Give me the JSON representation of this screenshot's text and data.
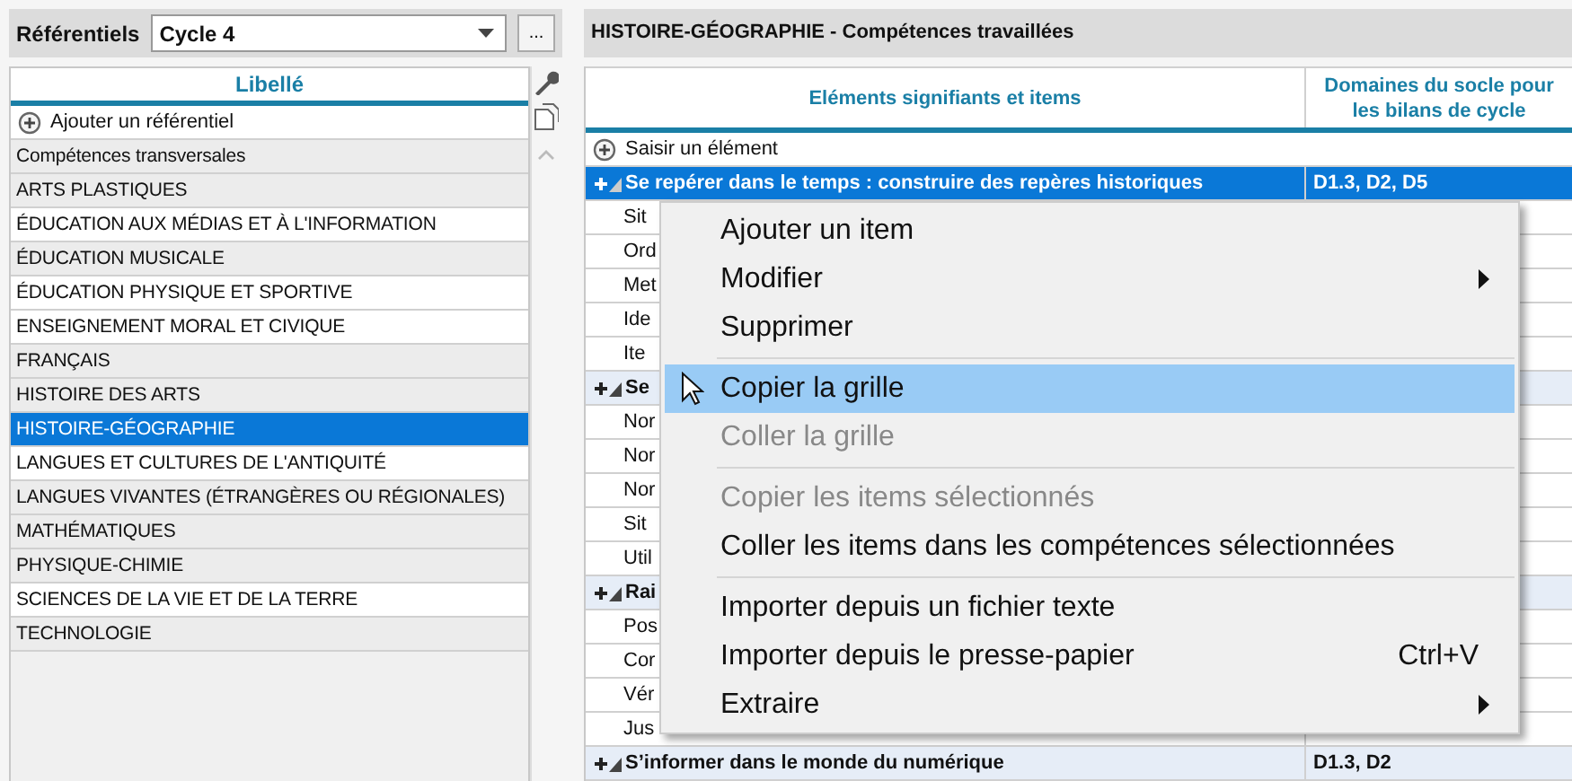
{
  "left_panel": {
    "label": "Référentiels",
    "select": {
      "value": "Cycle 4"
    },
    "more_button": "...",
    "list": {
      "column": "Libellé",
      "add_label": "Ajouter un référentiel",
      "items": [
        {
          "label": "Compétences transversales",
          "shaded": true,
          "selected": false
        },
        {
          "label": "ARTS PLASTIQUES",
          "shaded": true,
          "selected": false
        },
        {
          "label": "ÉDUCATION AUX MÉDIAS ET À L'INFORMATION",
          "shaded": false,
          "selected": false
        },
        {
          "label": "ÉDUCATION MUSICALE",
          "shaded": true,
          "selected": false
        },
        {
          "label": "ÉDUCATION PHYSIQUE ET SPORTIVE",
          "shaded": false,
          "selected": false
        },
        {
          "label": "ENSEIGNEMENT MORAL ET CIVIQUE",
          "shaded": false,
          "selected": false
        },
        {
          "label": "FRANÇAIS",
          "shaded": true,
          "selected": false
        },
        {
          "label": "HISTOIRE DES ARTS",
          "shaded": true,
          "selected": false
        },
        {
          "label": "HISTOIRE-GÉOGRAPHIE",
          "shaded": false,
          "selected": true
        },
        {
          "label": "LANGUES ET CULTURES DE L'ANTIQUITÉ",
          "shaded": false,
          "selected": false
        },
        {
          "label": "LANGUES VIVANTES (ÉTRANGÈRES OU RÉGIONALES)",
          "shaded": true,
          "selected": false
        },
        {
          "label": "MATHÉMATIQUES",
          "shaded": true,
          "selected": false
        },
        {
          "label": "PHYSIQUE-CHIMIE",
          "shaded": true,
          "selected": false
        },
        {
          "label": "SCIENCES DE LA VIE ET DE LA TERRE",
          "shaded": false,
          "selected": false
        },
        {
          "label": "TECHNOLOGIE",
          "shaded": true,
          "selected": false
        }
      ]
    }
  },
  "right_panel": {
    "title": "HISTOIRE-GÉOGRAPHIE - Compétences travaillées",
    "table": {
      "columns": [
        "Eléments signifiants et items",
        "Domaines du socle pour les bilans de cycle"
      ],
      "add_label": "Saisir un élément",
      "rows": [
        {
          "kind": "group",
          "text": "Se repérer dans le temps : construire des repères historiques",
          "domains": "D1.3, D2, D5",
          "selected": true
        },
        {
          "kind": "item",
          "text": "Sit",
          "selected": false
        },
        {
          "kind": "item",
          "text": "Ord",
          "selected": false
        },
        {
          "kind": "item",
          "text": "Met",
          "selected": false
        },
        {
          "kind": "item",
          "text": "Ide",
          "selected": false
        },
        {
          "kind": "item",
          "text": "Ite",
          "selected": false
        },
        {
          "kind": "group",
          "text": "Se",
          "selected": false
        },
        {
          "kind": "item",
          "text": "Nor",
          "selected": false
        },
        {
          "kind": "item",
          "text": "Nor",
          "selected": false
        },
        {
          "kind": "item",
          "text": "Nor",
          "selected": false
        },
        {
          "kind": "item",
          "text": "Sit",
          "selected": false
        },
        {
          "kind": "item",
          "text": "Util",
          "selected": false
        },
        {
          "kind": "group",
          "text": "Rai",
          "selected": false
        },
        {
          "kind": "item",
          "text": "Pos",
          "selected": false
        },
        {
          "kind": "item",
          "text": "Cor",
          "selected": false
        },
        {
          "kind": "item",
          "text": "Vér",
          "selected": false
        },
        {
          "kind": "item",
          "text": "Jus",
          "selected": false
        },
        {
          "kind": "group",
          "text": "S’informer dans le monde du numérique",
          "domains": "D1.3, D2",
          "selected": false
        }
      ]
    }
  },
  "context_menu": {
    "items": [
      {
        "kind": "entry",
        "label": "Ajouter un item",
        "disabled": false,
        "selected": false
      },
      {
        "kind": "entry",
        "label": "Modifier",
        "submenu": true,
        "disabled": false,
        "selected": false
      },
      {
        "kind": "entry",
        "label": "Supprimer",
        "disabled": false,
        "selected": false
      },
      {
        "kind": "separator"
      },
      {
        "kind": "entry",
        "label": "Copier la grille",
        "disabled": false,
        "selected": true
      },
      {
        "kind": "entry",
        "label": "Coller la grille",
        "disabled": true,
        "selected": false
      },
      {
        "kind": "separator"
      },
      {
        "kind": "entry",
        "label": "Copier les items sélectionnés",
        "disabled": true,
        "selected": false
      },
      {
        "kind": "entry",
        "label": "Coller les items dans les compétences sélectionnées",
        "disabled": false,
        "selected": false
      },
      {
        "kind": "separator"
      },
      {
        "kind": "entry",
        "label": "Importer depuis un fichier texte",
        "disabled": false,
        "selected": false
      },
      {
        "kind": "entry",
        "label": "Importer depuis le presse-papier",
        "shortcut": "Ctrl+V",
        "disabled": false,
        "selected": false
      },
      {
        "kind": "entry",
        "label": "Extraire",
        "submenu": true,
        "disabled": false,
        "selected": false
      }
    ]
  }
}
